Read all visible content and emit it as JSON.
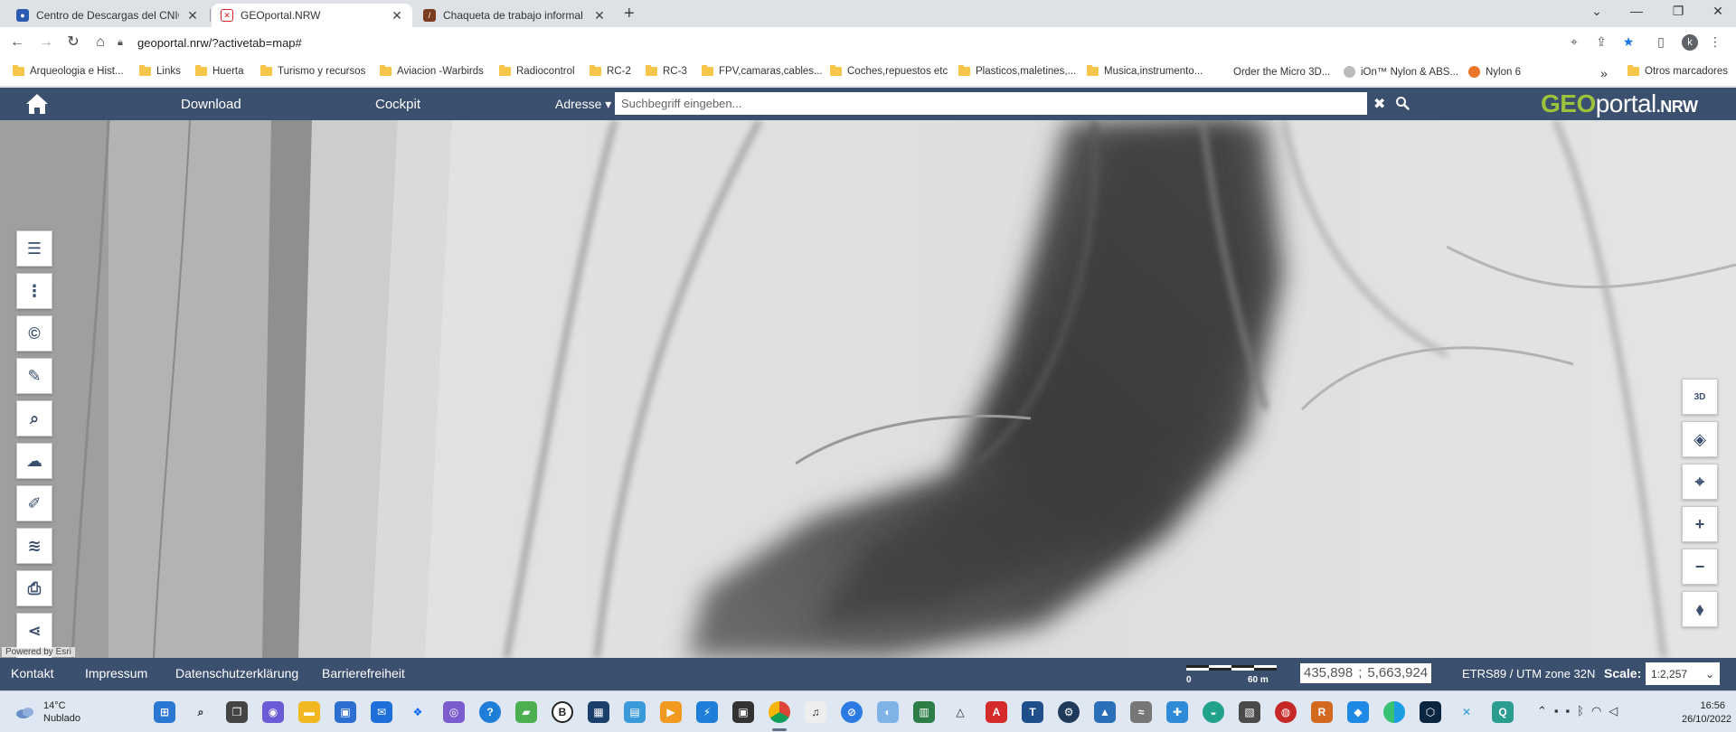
{
  "browser": {
    "tabs": [
      {
        "title": "Centro de Descargas del CNIG (I",
        "icon": "globe-icon",
        "color": "#2a5bb0",
        "active": false
      },
      {
        "title": "GEOportal.NRW",
        "icon": "geoportal-favicon",
        "color": "#d4262a",
        "active": true
      },
      {
        "title": "Chaqueta de trabajo informal cá",
        "icon": "shop-favicon",
        "color": "#7a3b1e",
        "active": false
      }
    ],
    "new_tab": "+",
    "url": "geoportal.nrw/?activetab=map#",
    "profile_initial": "k",
    "bookmarks": [
      {
        "label": "Arqueologia e Hist...",
        "type": "folder"
      },
      {
        "label": "Links",
        "type": "folder"
      },
      {
        "label": "Huerta",
        "type": "folder"
      },
      {
        "label": "Turismo y recursos",
        "type": "folder"
      },
      {
        "label": "Aviacion -Warbirds",
        "type": "folder"
      },
      {
        "label": "Radiocontrol",
        "type": "folder"
      },
      {
        "label": "RC-2",
        "type": "folder"
      },
      {
        "label": "RC-3",
        "type": "folder"
      },
      {
        "label": "FPV,camaras,cables...",
        "type": "folder"
      },
      {
        "label": "Coches,repuestos etc",
        "type": "folder"
      },
      {
        "label": "Plasticos,maletines,...",
        "type": "folder"
      },
      {
        "label": "Musica,instrumento...",
        "type": "folder"
      },
      {
        "label": "Order the Micro 3D...",
        "type": "site"
      },
      {
        "label": "iOn™ Nylon & ABS...",
        "type": "site"
      },
      {
        "label": "Nylon 6",
        "type": "site"
      }
    ],
    "bookmarks_more": "»",
    "other_bookmarks": "Otros marcadores"
  },
  "header": {
    "download": "Download",
    "cockpit": "Cockpit",
    "adresse": "Adresse",
    "search_placeholder": "Suchbegriff eingeben...",
    "logo_geo": "GEO",
    "logo_portal": "portal",
    "logo_nrw": ".NRW"
  },
  "map": {
    "left_tools": [
      "list-icon",
      "more-vertical-icon",
      "copyright-icon",
      "wrench-icon",
      "document-search-icon",
      "cloud-download-icon",
      "pencil-icon",
      "layers-settings-icon",
      "printer-icon",
      "share-icon",
      "help-icon"
    ],
    "help_glyph": "?",
    "right_tools": [
      "3d-view-icon",
      "layers-icon",
      "locate-icon",
      "zoom-in-icon",
      "zoom-out-icon",
      "compass-icon"
    ],
    "zoom_in": "+",
    "zoom_out": "−",
    "three_d": "3D",
    "powered_by": "Powered by Esri"
  },
  "footer": {
    "links": [
      "Kontakt",
      "Impressum",
      "Datenschutzerklärung",
      "Barrierefreiheit"
    ],
    "scalebar_start": "0",
    "scalebar_end": "60 m",
    "coord_x": "435,898",
    "coord_sep": ";",
    "coord_y": "5,663,924",
    "crs": "ETRS89 / UTM zone 32N",
    "scale_label": "Scale:",
    "scale_value": "1:2,257"
  },
  "taskbar": {
    "temperature": "14°C",
    "weather": "Nublado",
    "time": "16:56",
    "date": "26/10/2022"
  }
}
